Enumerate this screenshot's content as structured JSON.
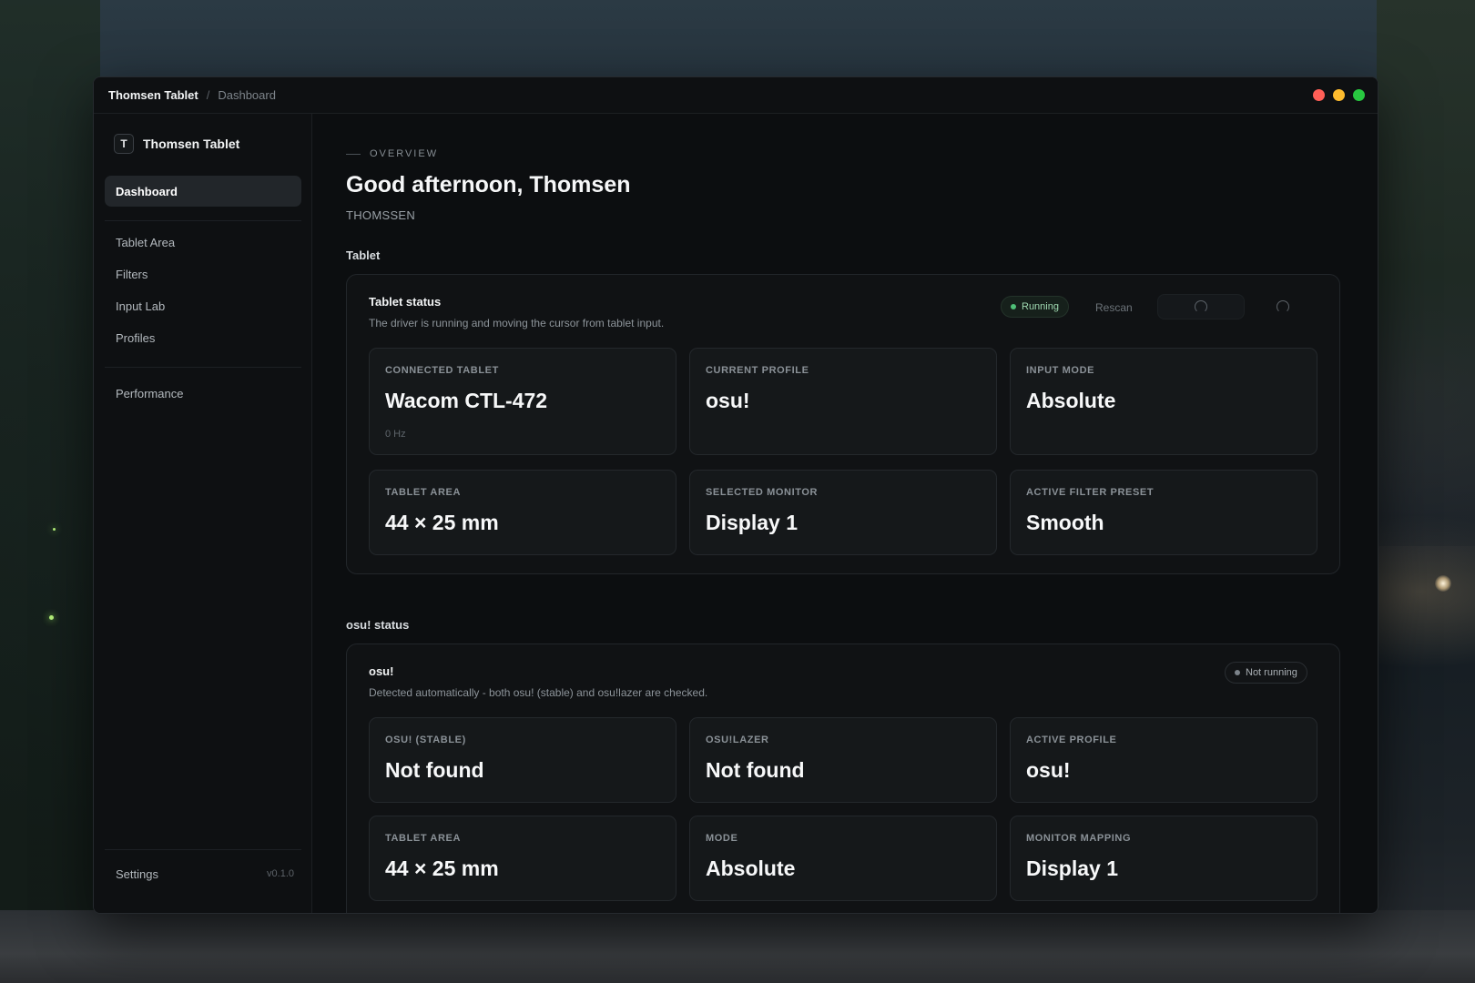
{
  "titlebar": {
    "app": "Thomsen Tablet",
    "separator": "/",
    "page": "Dashboard"
  },
  "sidebar": {
    "brand_mark": "T",
    "brand_name": "Thomsen Tablet",
    "active_item": "Dashboard",
    "items": [
      "Tablet Area",
      "Filters",
      "Input Lab",
      "Profiles"
    ],
    "secondary_items": [
      "Performance"
    ],
    "footer": {
      "settings": "Settings",
      "version": "v0.1.0"
    }
  },
  "main": {
    "eyebrow": "OVERVIEW",
    "greeting": "Good afternoon, Thomsen",
    "username": "THOMSSEN",
    "tablet_section": {
      "label": "Tablet",
      "title": "Tablet status",
      "description": "The driver is running and moving the cursor from tablet input.",
      "status": "Running",
      "rescan": "Rescan",
      "stats": [
        {
          "label": "CONNECTED TABLET",
          "value": "Wacom CTL-472",
          "note": "0 Hz"
        },
        {
          "label": "CURRENT PROFILE",
          "value": "osu!"
        },
        {
          "label": "INPUT MODE",
          "value": "Absolute"
        },
        {
          "label": "TABLET AREA",
          "value": "44 × 25 mm"
        },
        {
          "label": "SELECTED MONITOR",
          "value": "Display 1"
        },
        {
          "label": "ACTIVE FILTER PRESET",
          "value": "Smooth"
        }
      ]
    },
    "osu_section": {
      "label": "osu! status",
      "title": "osu!",
      "description": "Detected automatically - both osu! (stable) and osu!lazer are checked.",
      "status": "Not running",
      "stats": [
        {
          "label": "OSU! (STABLE)",
          "value": "Not found"
        },
        {
          "label": "OSU!LAZER",
          "value": "Not found"
        },
        {
          "label": "ACTIVE PROFILE",
          "value": "osu!"
        },
        {
          "label": "TABLET AREA",
          "value": "44 × 25 mm"
        },
        {
          "label": "MODE",
          "value": "Absolute"
        },
        {
          "label": "MONITOR MAPPING",
          "value": "Display 1"
        }
      ]
    }
  },
  "colors": {
    "accent_running": "#4fbf77",
    "window_bg": "#0c0e10",
    "card_bg": "#15181a",
    "traffic_red": "#ff5f57",
    "traffic_yellow": "#febc2e",
    "traffic_green": "#28c840"
  }
}
